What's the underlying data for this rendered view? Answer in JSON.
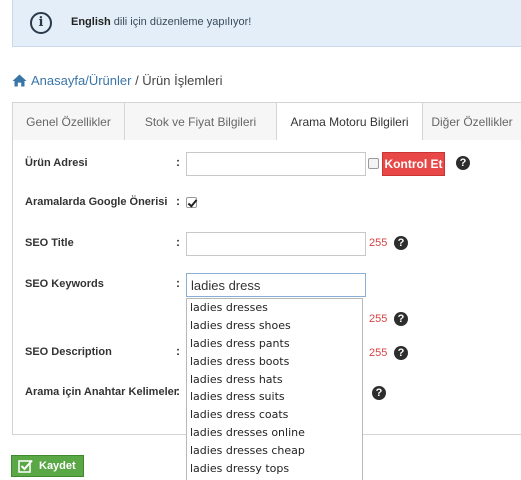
{
  "notice": {
    "lang": "English",
    "text": " dili için düzenleme yapılıyor!"
  },
  "breadcrumb": {
    "link": "Anasayfa/Ürünler",
    "separator": " / ",
    "current": "Ürün İşlemleri"
  },
  "tabs": [
    {
      "label": "Genel Özellikler"
    },
    {
      "label": "Stok ve Fiyat Bilgileri"
    },
    {
      "label": "Arama Motoru Bilgileri"
    },
    {
      "label": "Diğer Özellikler"
    }
  ],
  "form": {
    "product_url_label": "Ürün Adresi",
    "product_url_value": "",
    "check_button": "Kontrol Et",
    "google_suggest_label": "Aramalarda Google Önerisi",
    "seo_title_label": "SEO Title",
    "seo_title_value": "",
    "seo_title_count": "255",
    "seo_keywords_label": "SEO Keywords",
    "seo_keywords_value": "ladies dress",
    "seo_keywords_count": "255",
    "seo_description_label": "SEO Description",
    "seo_description_count": "255",
    "search_keywords_label": "Arama için Anahtar Kelimeler",
    "colon": ":",
    "help": "?"
  },
  "suggestions": [
    "ladies dresses",
    "ladies dress shoes",
    "ladies dress pants",
    "ladies dress boots",
    "ladies dress hats",
    "ladies dress suits",
    "ladies dress coats",
    "ladies dresses online",
    "ladies dresses cheap",
    "ladies dressy tops"
  ],
  "save_button": "Kaydet",
  "colors": {
    "accent_red": "#e84848",
    "save_green": "#5aa746",
    "link_blue": "#3a75a8",
    "notice_bg": "#e4eef8"
  },
  "icons": {
    "notice": "info-icon",
    "breadcrumb": "home-icon",
    "help": "help-circle-icon",
    "save": "checkbox-icon"
  }
}
